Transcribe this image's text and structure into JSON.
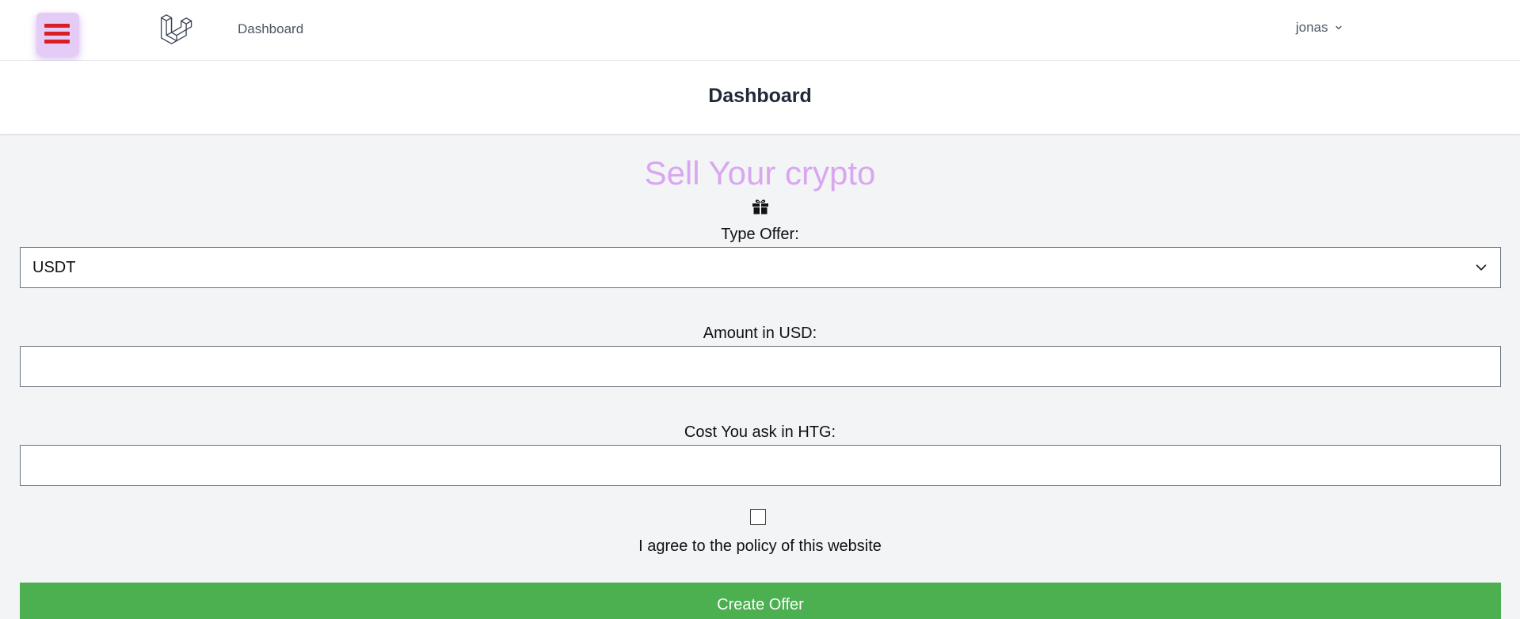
{
  "nav": {
    "links": [
      {
        "label": "Dashboard"
      }
    ],
    "user": {
      "name": "jonas"
    },
    "icons": {
      "menu": "hamburger-menu-icon",
      "logo": "laravel-logo",
      "user_dropdown": "chevron-down-icon"
    },
    "colors": {
      "menu_bg": "#e5ccf6",
      "menu_bars": "#d81f26"
    }
  },
  "header": {
    "title": "Dashboard"
  },
  "form": {
    "title": "Sell Your crypto",
    "title_color": "#d9a6f0",
    "title_icon": "gift-icon",
    "type_offer": {
      "label": "Type Offer:",
      "value": "USDT",
      "icon": "chevron-down-icon"
    },
    "amount_usd": {
      "label": "Amount in USD:",
      "value": "",
      "placeholder": ""
    },
    "cost_htg": {
      "label": "Cost You ask in HTG:",
      "value": "",
      "placeholder": ""
    },
    "policy": {
      "label": "I agree to the policy of this website",
      "checked": false
    },
    "submit": {
      "label": "Create Offer",
      "color": "#4caf50"
    }
  }
}
